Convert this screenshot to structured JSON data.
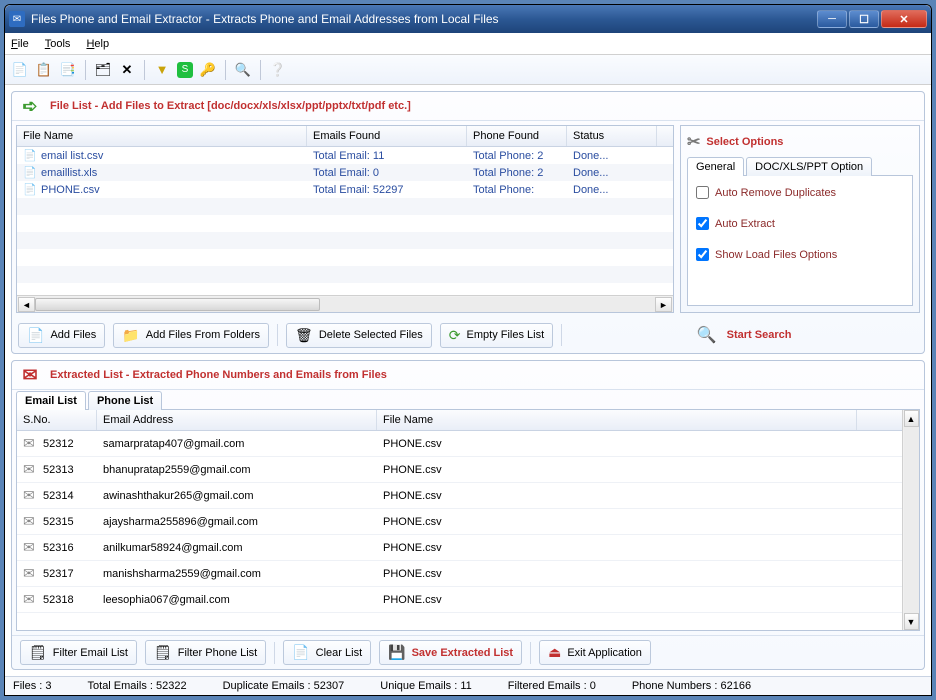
{
  "window": {
    "title": "Files Phone and Email Extractor  -  Extracts Phone and Email Addresses from Local Files"
  },
  "menu": {
    "file": "File",
    "tools": "Tools",
    "help": "Help"
  },
  "fileListSection": {
    "header": "File List - Add Files to Extract  [doc/docx/xls/xlsx/ppt/pptx/txt/pdf etc.]",
    "cols": {
      "name": "File Name",
      "emails": "Emails Found",
      "phone": "Phone Found",
      "status": "Status"
    },
    "rows": [
      {
        "name": "email list.csv",
        "emails": "Total Email: 11",
        "phone": "Total Phone: 2",
        "status": "Done..."
      },
      {
        "name": "emaillist.xls",
        "emails": "Total Email: 0",
        "phone": "Total Phone: 2",
        "status": "Done..."
      },
      {
        "name": "PHONE.csv",
        "emails": "Total Email: 52297",
        "phone": "Total Phone:",
        "status": "Done..."
      }
    ],
    "buttons": {
      "addFiles": "Add Files",
      "addFolders": "Add Files From Folders",
      "deleteSel": "Delete Selected Files",
      "empty": "Empty Files List"
    }
  },
  "options": {
    "header": "Select Options",
    "tab1": "General",
    "tab2": "DOC/XLS/PPT Option",
    "autoRemove": "Auto Remove Duplicates",
    "autoExtract": "Auto Extract",
    "showLoad": "Show Load Files Options"
  },
  "search": "Start Search",
  "extracted": {
    "header": "Extracted List - Extracted Phone Numbers and Emails from Files",
    "tabEmail": "Email List",
    "tabPhone": "Phone List",
    "cols": {
      "sno": "S.No.",
      "email": "Email Address",
      "file": "File Name"
    },
    "rows": [
      {
        "sno": "52312",
        "email": "samarpratap407@gmail.com",
        "file": "PHONE.csv"
      },
      {
        "sno": "52313",
        "email": "bhanupratap2559@gmail.com",
        "file": "PHONE.csv"
      },
      {
        "sno": "52314",
        "email": "awinashthakur265@gmail.com",
        "file": "PHONE.csv"
      },
      {
        "sno": "52315",
        "email": "ajaysharma255896@gmail.com",
        "file": "PHONE.csv"
      },
      {
        "sno": "52316",
        "email": "anilkumar58924@gmail.com",
        "file": "PHONE.csv"
      },
      {
        "sno": "52317",
        "email": "manishsharma2559@gmail.com",
        "file": "PHONE.csv"
      },
      {
        "sno": "52318",
        "email": "leesophia067@gmail.com",
        "file": "PHONE.csv"
      }
    ]
  },
  "bottom": {
    "filterEmail": "Filter Email List",
    "filterPhone": "Filter Phone List",
    "clear": "Clear List",
    "save": "Save Extracted List",
    "exit": "Exit Application"
  },
  "status": {
    "files": "Files :  3",
    "totalEmails": "Total Emails :  52322",
    "dup": "Duplicate Emails :  52307",
    "unique": "Unique Emails :  11",
    "filtered": "Filtered Emails :  0",
    "phone": "Phone Numbers :  62166"
  }
}
